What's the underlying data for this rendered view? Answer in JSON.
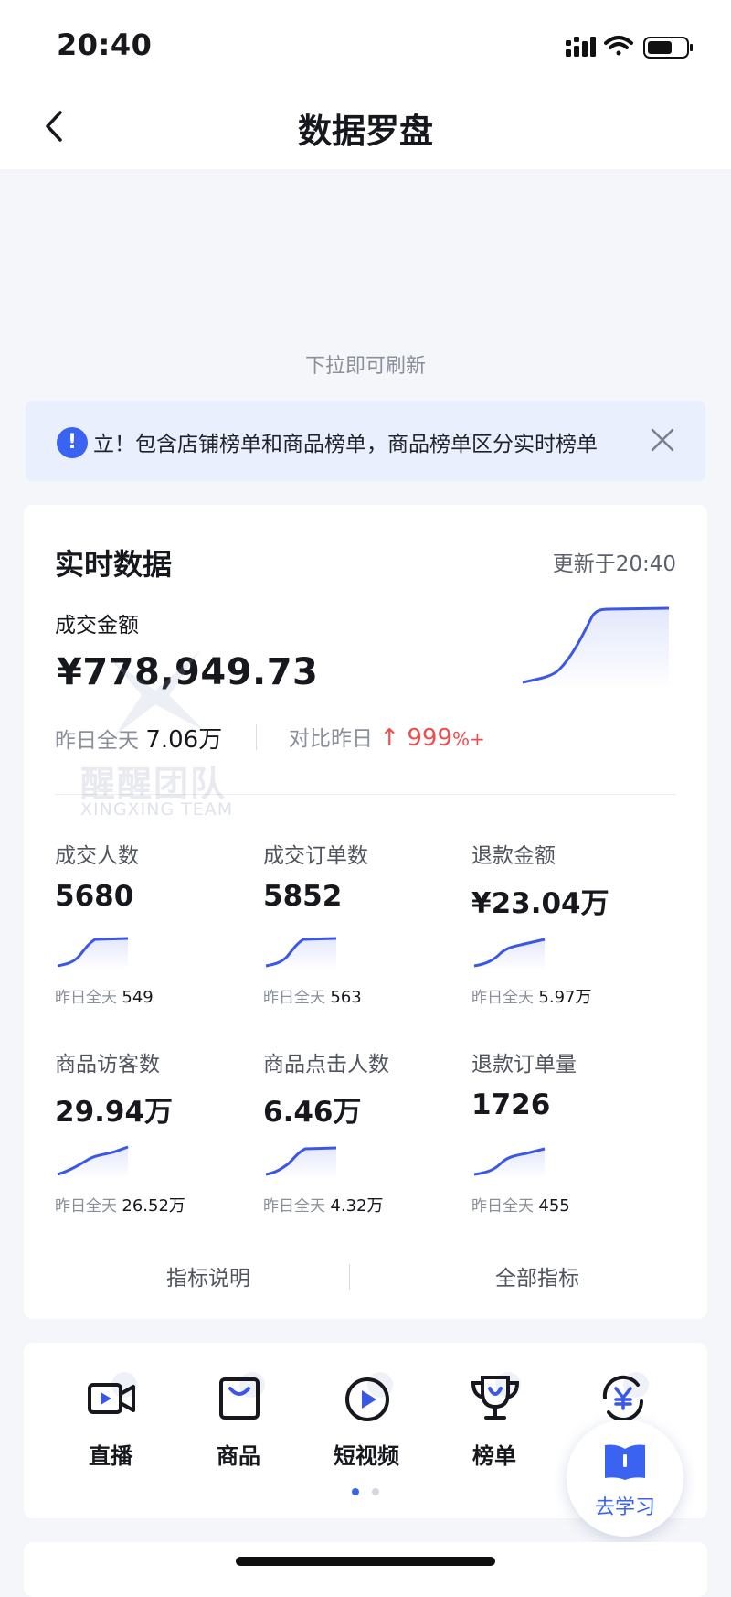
{
  "status_bar": {
    "time": "20:40"
  },
  "nav": {
    "title": "数据罗盘",
    "back_icon": "chevron-left-icon"
  },
  "pull_hint": "下拉即可刷新",
  "notice": {
    "text": "立！包含店铺榜单和商品榜单，商品榜单区分实时榜单",
    "icon": "alert-icon",
    "close_icon": "close-icon"
  },
  "realtime": {
    "title": "实时数据",
    "updated": "更新于20:40",
    "gmv": {
      "label": "成交金额",
      "value": "¥778,949.73",
      "yesterday_label": "昨日全天",
      "yesterday_value": "7.06万",
      "compare_label": "对比昨日",
      "compare_value": "↑ 999",
      "compare_suffix": "%+"
    },
    "metrics": [
      {
        "label": "成交人数",
        "value": "5680",
        "yesterday_label": "昨日全天",
        "yesterday_value": "549"
      },
      {
        "label": "成交订单数",
        "value": "5852",
        "yesterday_label": "昨日全天",
        "yesterday_value": "563"
      },
      {
        "label": "退款金额",
        "value": "¥23.04万",
        "yesterday_label": "昨日全天",
        "yesterday_value": "5.97万"
      },
      {
        "label": "商品访客数",
        "value": "29.94万",
        "yesterday_label": "昨日全天",
        "yesterday_value": "26.52万"
      },
      {
        "label": "商品点击人数",
        "value": "6.46万",
        "yesterday_label": "昨日全天",
        "yesterday_value": "4.32万"
      },
      {
        "label": "退款订单量",
        "value": "1726",
        "yesterday_label": "昨日全天",
        "yesterday_value": "455"
      }
    ],
    "footer": {
      "left": "指标说明",
      "right": "全部指标"
    }
  },
  "watermark": {
    "cn": "醒醒团队",
    "en": "XINGXING TEAM"
  },
  "tools": [
    {
      "label": "直播",
      "icon": "video-camera-icon"
    },
    {
      "label": "商品",
      "icon": "shopping-bag-icon"
    },
    {
      "label": "短视频",
      "icon": "play-circle-icon"
    },
    {
      "label": "榜单",
      "icon": "trophy-icon"
    },
    {
      "label": "",
      "icon": "yuan-refresh-icon"
    }
  ],
  "pager": {
    "pages": 2,
    "current": 1
  },
  "learn": {
    "label": "去学习",
    "icon": "book-icon"
  },
  "colors": {
    "accent": "#3b63f2",
    "up": "#ee4d4d",
    "page_bg": "#f5f6f9"
  }
}
